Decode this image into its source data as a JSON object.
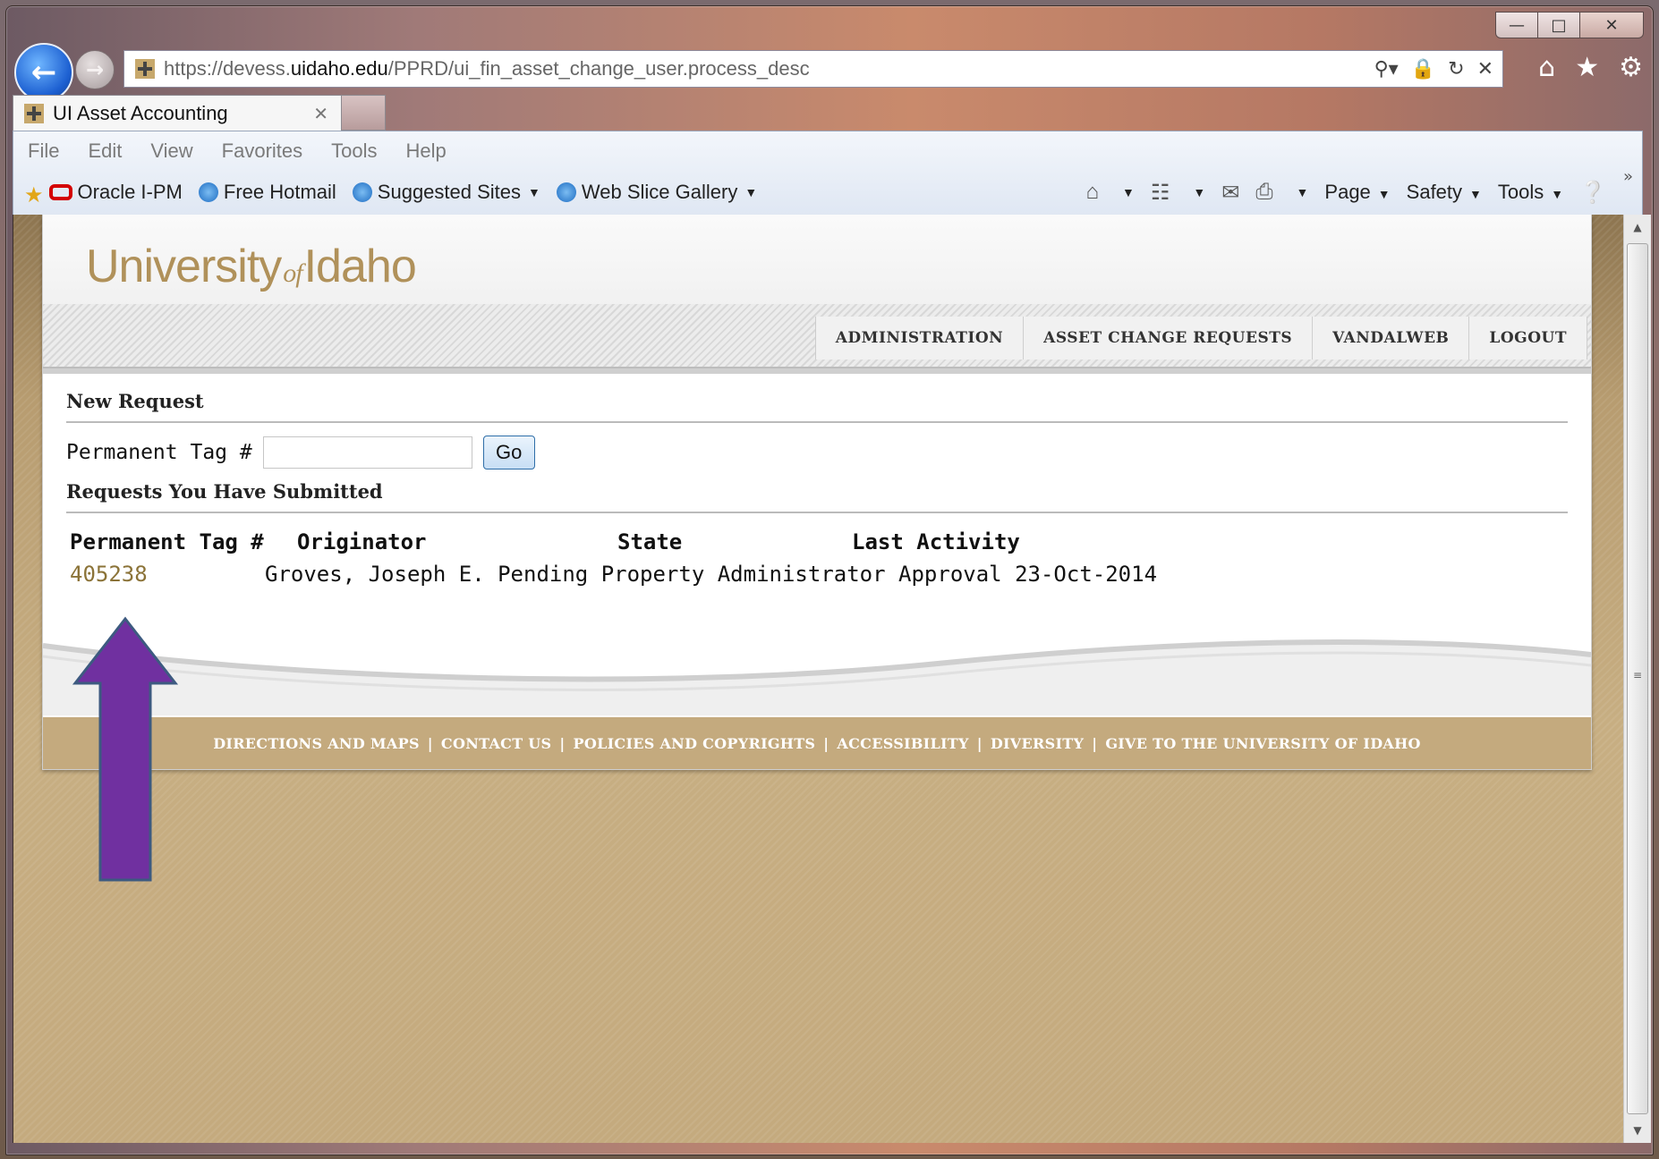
{
  "browser": {
    "url_prefix": "https://devess.",
    "url_domain": "uidaho.edu",
    "url_path": "/PPRD/ui_fin_asset_change_user.process_desc",
    "tab_title": "UI Asset Accounting",
    "menu": [
      "File",
      "Edit",
      "View",
      "Favorites",
      "Tools",
      "Help"
    ],
    "favorites": [
      "Oracle I-PM",
      "Free Hotmail",
      "Suggested Sites",
      "Web Slice Gallery"
    ],
    "commands": [
      "Page",
      "Safety",
      "Tools"
    ]
  },
  "site": {
    "logo_left": "University",
    "logo_of": "of",
    "logo_right": "Idaho",
    "nav": [
      "ADMINISTRATION",
      "ASSET CHANGE REQUESTS",
      "VANDALWEB",
      "LOGOUT"
    ]
  },
  "form": {
    "new_request_title": "New Request",
    "tag_label": "Permanent Tag #",
    "tag_value": "",
    "go_label": "Go"
  },
  "requests": {
    "title": "Requests You Have Submitted",
    "headers": [
      "Permanent Tag #",
      "Originator",
      "State",
      "Last Activity"
    ],
    "rows": [
      {
        "tag": "405238",
        "originator": "Groves, Joseph E.",
        "state": "Pending Property Administrator Approval",
        "last_activity": "23-Oct-2014"
      }
    ]
  },
  "footer_links": [
    "DIRECTIONS AND MAPS",
    "CONTACT US",
    "POLICIES AND COPYRIGHTS",
    "ACCESSIBILITY",
    "DIVERSITY",
    "GIVE TO THE UNIVERSITY OF IDAHO"
  ],
  "colors": {
    "gold": "#c4aa7e",
    "link": "#8b7338",
    "annotation_arrow": "#7030a0"
  }
}
